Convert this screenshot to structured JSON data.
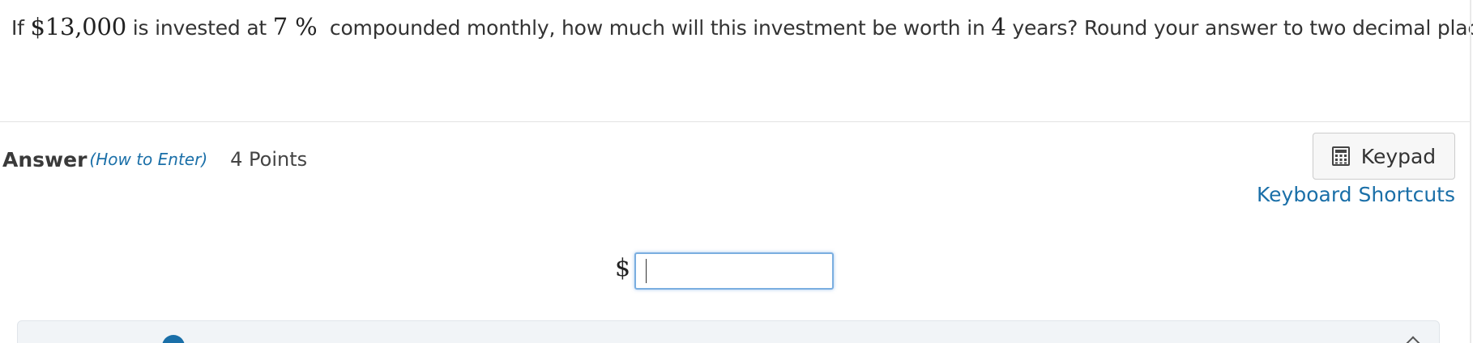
{
  "question": {
    "prefix": "If ",
    "principal": "$13,000",
    "mid1": " is invested at ",
    "rate": "7 %",
    "mid2": "  compounded monthly, how much will this investment be worth in ",
    "years": "4",
    "suffix": " years? Round your answer to two decimal places."
  },
  "answer": {
    "label": "Answer",
    "how_to_label": "(How to Enter)",
    "points": "4 Points",
    "currency_symbol": "$",
    "input_value": "",
    "input_placeholder": ""
  },
  "toolbar": {
    "keypad_label": "Keypad",
    "keypad_icon": "calculator-icon",
    "shortcuts_label": "Keyboard Shortcuts"
  },
  "panel": {
    "info_icon": "info-icon"
  },
  "colors": {
    "link": "#1a6fa8",
    "input_focus_border": "#7aaee0",
    "panel_background": "#f1f4f7"
  }
}
